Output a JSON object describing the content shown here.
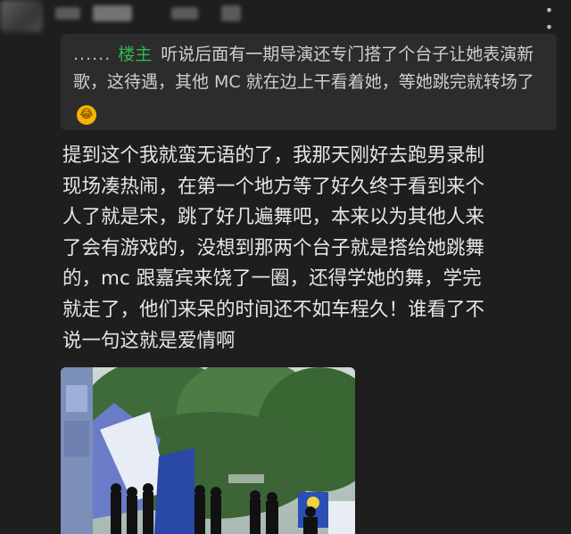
{
  "header": {
    "more_icon": "ellipsis-icon"
  },
  "quote": {
    "ellipsis": "......",
    "op_badge": "楼主",
    "text": "听说后面有一期导演还专门搭了个台子让她表演新歌，这待遇，其他 MC 就在边上干看着她，等她跳完就转场了",
    "emoji": "rolling-laughing-emoji"
  },
  "comment": {
    "lines": [
      "提到这个我就蛮无语的了，我那天刚好去跑男录制",
      "现场凑热闹，在第一个地方等了好久终于看到来个",
      "人了就是宋，跳了好几遍舞吧，本来以为其他人来",
      "了会有游戏的，没想到那两个台子就是搭给她跳舞",
      "的，mc 跟嘉宾来饶了一圈，还得学她的舞，学完",
      "就走了，他们来呆的时间还不如车程久！谁看了不",
      "说一句这就是爱情啊"
    ]
  },
  "photo": {
    "description_icon": "photo-image"
  },
  "colors": {
    "background": "#1e1e1e",
    "quote_bg": "#2c2c2c",
    "op_badge": "#2fb84f",
    "text": "#e6e6e6"
  }
}
